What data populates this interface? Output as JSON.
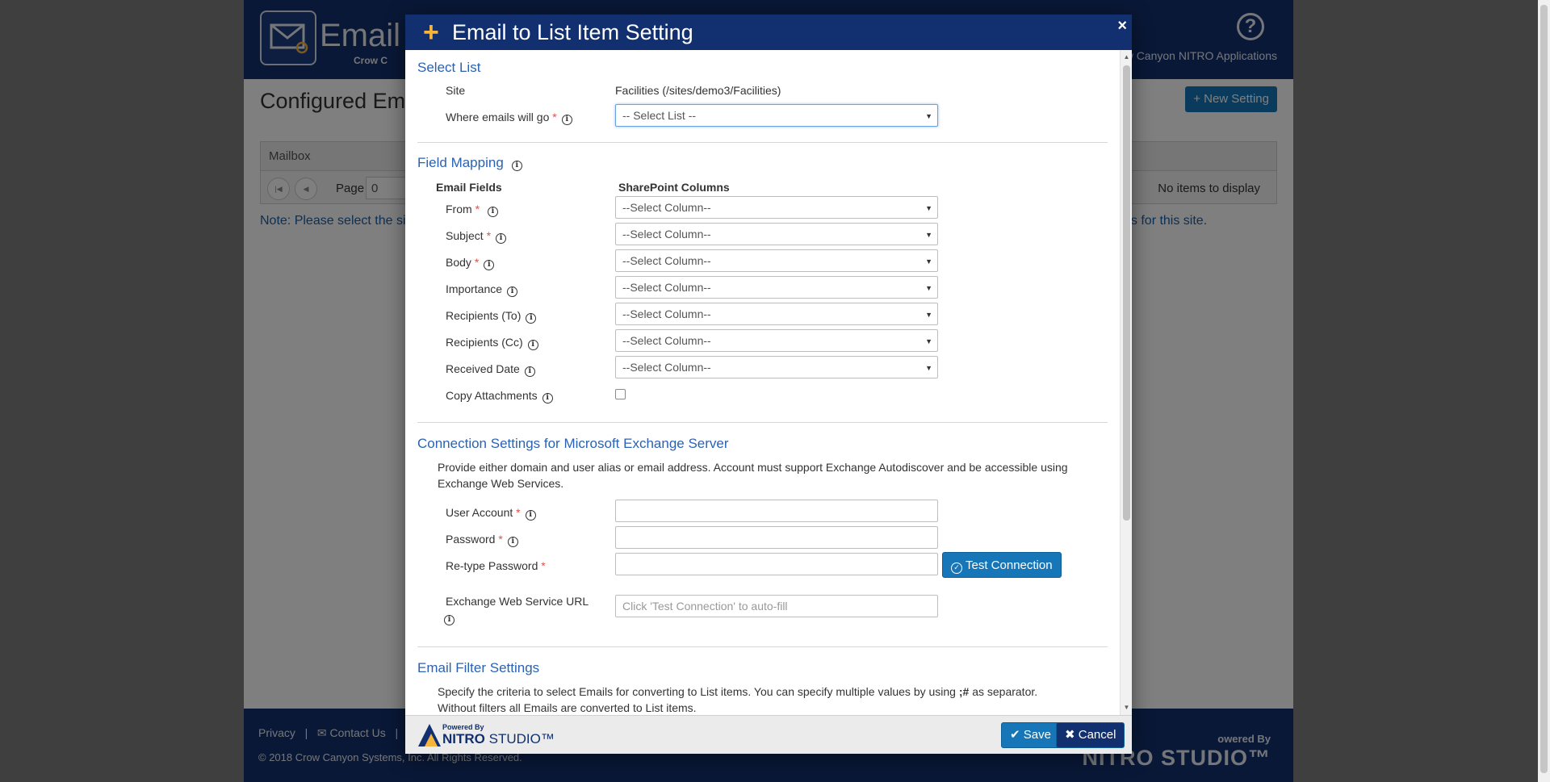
{
  "background_app": {
    "title": "Email",
    "brand": "Crow C",
    "help_icon": "question-circle-icon",
    "nitro_link": "w Canyon NITRO Applications",
    "page_title": "Configured Ema",
    "new_setting_label": "+ New Setting",
    "grid": {
      "column_header": "Mailbox",
      "page_label": "Page",
      "page_value": "0",
      "no_items": "No items to display"
    },
    "note_left": "Note: Please select the sit",
    "note_right": "gs for this site.",
    "footer": {
      "privacy": "Privacy",
      "separator": "|",
      "contact": "Contact Us",
      "separator2": "|",
      "copyright": "© 2018 Crow Canyon Systems, Inc. All Rights Reserved.",
      "powered": "owered By",
      "nitro": "NITRO STUDIO™"
    }
  },
  "modal": {
    "title": "Email to List Item Setting",
    "plus_icon": "plus-icon",
    "close_label": "×",
    "select_list": {
      "title": "Select List",
      "site_label": "Site",
      "site_value": "Facilities (/sites/demo3/Facilities)",
      "where_label": "Where emails will go",
      "where_value": "-- Select List --"
    },
    "field_mapping": {
      "title": "Field Mapping",
      "col_email": "Email Fields",
      "col_sharepoint": "SharePoint Columns",
      "select_placeholder": "--Select Column--",
      "fields": [
        {
          "label": "From",
          "required": true
        },
        {
          "label": "Subject",
          "required": true
        },
        {
          "label": "Body",
          "required": true
        },
        {
          "label": "Importance",
          "required": false
        },
        {
          "label": "Recipients (To)",
          "required": false
        },
        {
          "label": "Recipients (Cc)",
          "required": false
        },
        {
          "label": "Received Date",
          "required": false
        }
      ],
      "copy_attachments_label": "Copy Attachments"
    },
    "connection": {
      "title": "Connection Settings for Microsoft Exchange Server",
      "help": "Provide either domain and user alias or email address. Account must support Exchange Autodiscover and be accessible using Exchange Web Services.",
      "user_account_label": "User Account",
      "password_label": "Password",
      "retype_label": "Re-type Password",
      "test_connection_label": "Test Connection",
      "ews_label": "Exchange Web Service URL",
      "ews_placeholder": "Click 'Test Connection' to auto-fill"
    },
    "email_filter": {
      "title": "Email Filter Settings",
      "help_before": "Specify the criteria to select Emails for converting to List items. You can specify multiple values by using ",
      "help_separator": ";#",
      "help_after": " as separator.",
      "help_line2": "Without filters all Emails are converted to List items."
    },
    "footer": {
      "powered": "Powered By",
      "nitro": "NITRO",
      "studio": "STUDIO™",
      "save_label": "Save",
      "cancel_label": "Cancel"
    }
  },
  "colors": {
    "header_navy": "#12306f",
    "accent_blue": "#1676b8",
    "section_blue": "#2b62b3",
    "required_red": "#d9534f",
    "plus_orange": "#f6b43c"
  }
}
